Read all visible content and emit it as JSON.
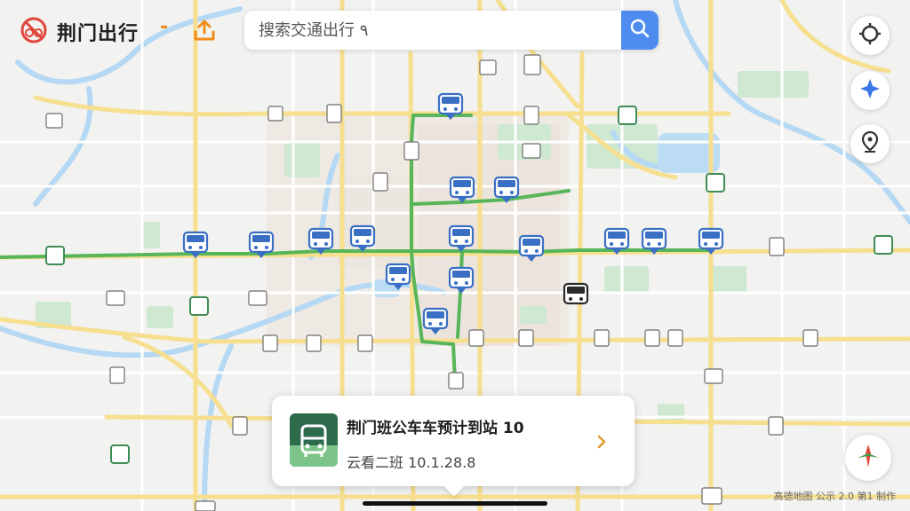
{
  "app": {
    "title": "荆门出行",
    "separator": "-"
  },
  "search": {
    "placeholder": "搜索交通出行 ۹",
    "value": ""
  },
  "card": {
    "title": "荆门班公车车预计到站 10",
    "subtitle": "云看二班 10.1.28.8"
  },
  "attribution": "高德地图 公示 2.0 第1 制作",
  "icons": {
    "logo": "no-bike-icon",
    "upload": "upload-icon",
    "search": "search-icon",
    "locate": "gps-crosshair-icon",
    "compass": "compass-icon",
    "location_pin": "location-pin-icon",
    "navigate": "navigate-arrow-icon",
    "bus": "bus-icon"
  },
  "colors": {
    "accent_blue": "#4e8cf0",
    "route_green": "#58b65a",
    "bus_blue": "#3a6fc4",
    "card_icon_green": "#2e6b4c",
    "brand_red": "#e0443a",
    "brand_orange": "#f08c1a"
  },
  "map": {
    "bus_count_blue": 16,
    "bus_count_dark": 1
  }
}
